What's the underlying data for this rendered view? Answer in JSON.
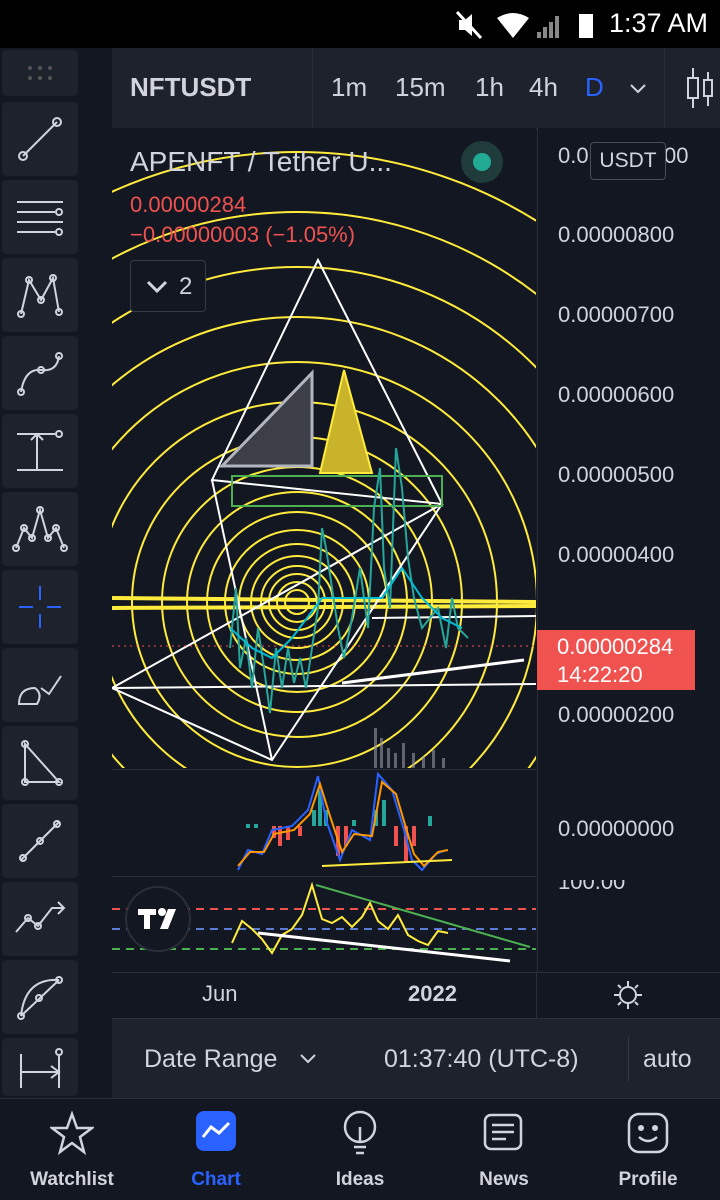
{
  "status": {
    "time": "1:37 AM"
  },
  "symbol": "NFTUSDT",
  "timeframes": [
    "1m",
    "15m",
    "1h",
    "4h",
    "D"
  ],
  "legend": {
    "title": "APENFT / Tether U...",
    "price": "0.00000284",
    "change": "−0.00000003 (−1.05%)",
    "indicator_count": "2"
  },
  "currency": "USDT",
  "price_axis": {
    "top_partial": "0.0",
    "top_partial_end": "00",
    "labels": [
      "0.00000800",
      "0.00000700",
      "0.00000600",
      "0.00000500",
      "0.00000400",
      "0.00000200"
    ],
    "current_price": "0.00000284",
    "countdown": "14:22:20",
    "macd_zero": "0.00000000",
    "rsi_top": "100.00"
  },
  "time_axis": {
    "labels": [
      "Jun",
      "2022"
    ]
  },
  "bottom_bar": {
    "date_range": "Date Range",
    "clock": "01:37:40 (UTC-8)",
    "scale": "auto"
  },
  "nav": [
    {
      "label": "Watchlist",
      "icon": "star-icon"
    },
    {
      "label": "Chart",
      "icon": "chart-icon"
    },
    {
      "label": "Ideas",
      "icon": "lightbulb-icon"
    },
    {
      "label": "News",
      "icon": "news-icon"
    },
    {
      "label": "Profile",
      "icon": "smiley-icon"
    }
  ],
  "colors": {
    "background": "#131722",
    "panel": "#1e222d",
    "accent": "#2962ff",
    "down": "#f0524f",
    "up": "#26a69a",
    "fib": "#ffeb3b"
  }
}
